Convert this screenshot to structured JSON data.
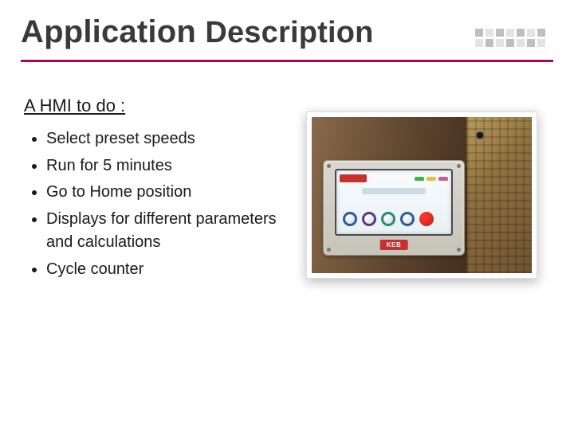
{
  "title": {
    "part1": "Application",
    "part2": "Description"
  },
  "subheading": "A HMI to do :",
  "items": [
    "Select preset speeds",
    "Run for 5 minutes",
    "Go to Home position",
    "Displays for different parameters and calculations",
    "Cycle counter"
  ],
  "panel_brand": "KEB"
}
